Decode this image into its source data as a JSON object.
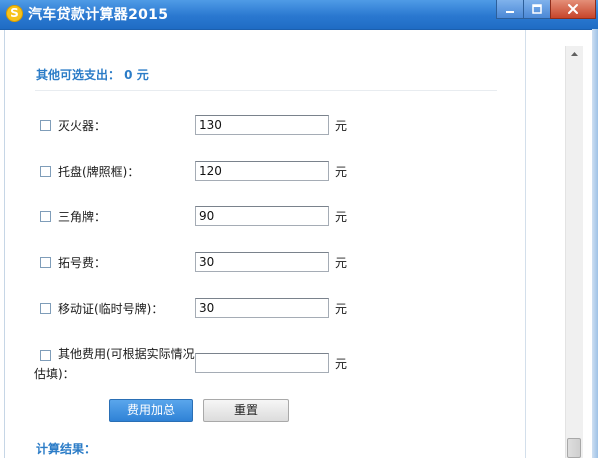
{
  "window": {
    "title": "汽车贷款计算器2015",
    "app_icon": "dollar-coin-icon",
    "controls": [
      "minimize-icon",
      "maximize-icon",
      "close-icon"
    ]
  },
  "section": {
    "title": "其他可选支出： 0 元"
  },
  "items": [
    {
      "label": "灭火器：",
      "value": "130",
      "unit": "元"
    },
    {
      "label": "托盘(牌照框)：",
      "value": "120",
      "unit": "元"
    },
    {
      "label": "三角牌：",
      "value": "90",
      "unit": "元"
    },
    {
      "label": "拓号费：",
      "value": "30",
      "unit": "元"
    },
    {
      "label": "移动证(临时号牌)：",
      "value": "30",
      "unit": "元"
    },
    {
      "label_line1": "其他费用(可根据实际情况",
      "label_line2": "估填)：",
      "value": "",
      "unit": "元"
    }
  ],
  "buttons": {
    "sum": "费用加总",
    "reset": "重置"
  },
  "result": {
    "title": "计算结果："
  },
  "colors": {
    "titlebar": "#2a78d0",
    "accent_text": "#2b7cc7",
    "primary_button": "#2f82d6"
  }
}
